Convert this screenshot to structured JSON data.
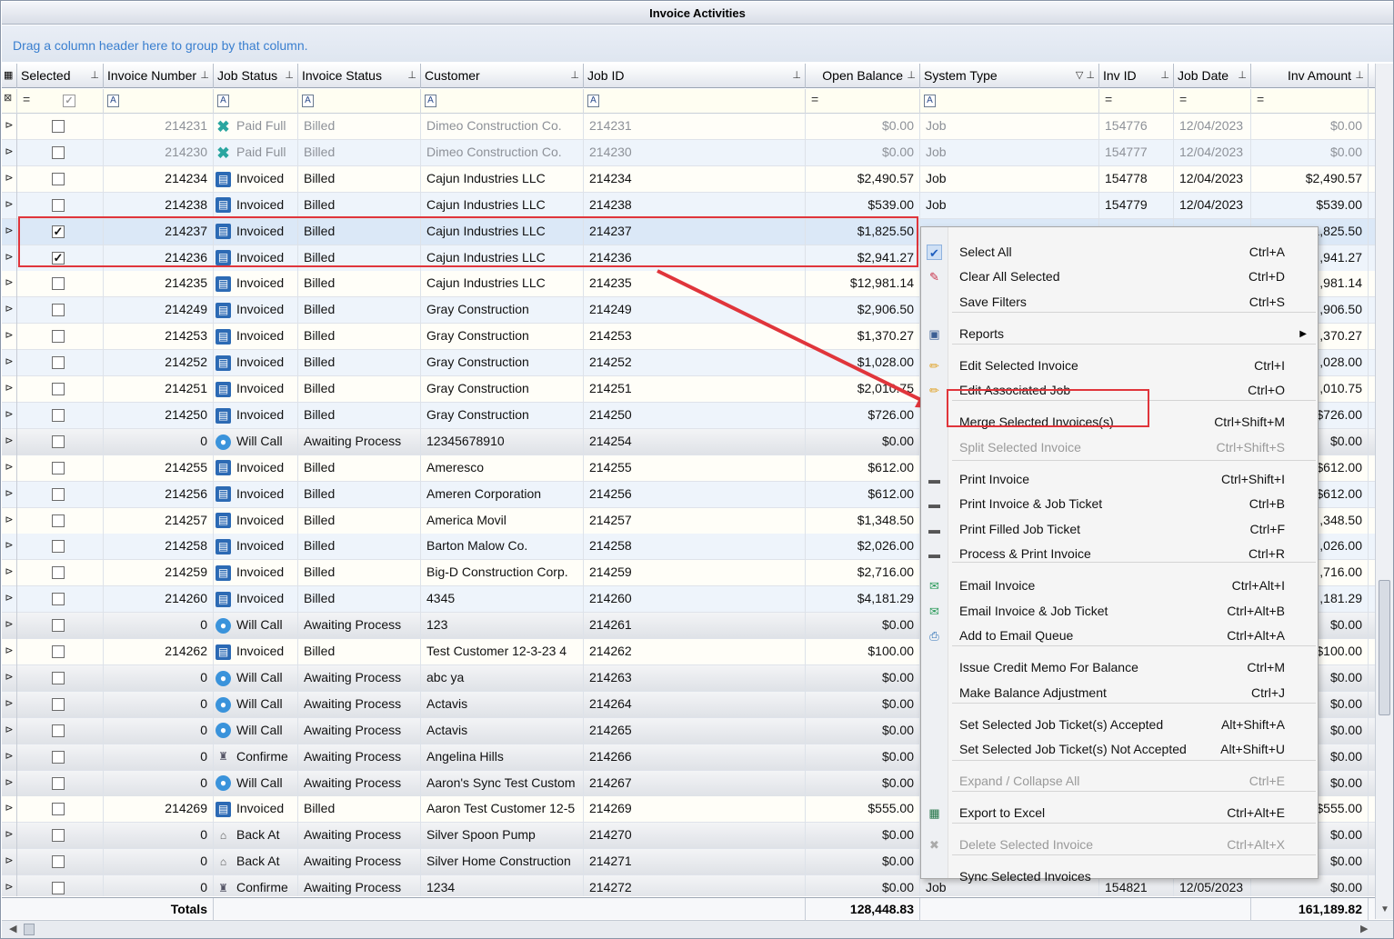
{
  "window": {
    "title": "Invoice Activities"
  },
  "group_hint": "Drag a column header here to group by that column.",
  "columns": [
    {
      "label": "Selected"
    },
    {
      "label": "Invoice Number"
    },
    {
      "label": "Job Status"
    },
    {
      "label": "Invoice Status"
    },
    {
      "label": "Customer"
    },
    {
      "label": "Job ID"
    },
    {
      "label": "Open Balance"
    },
    {
      "label": "System Type"
    },
    {
      "label": "Inv ID"
    },
    {
      "label": "Job Date"
    },
    {
      "label": "Inv Amount"
    }
  ],
  "rows": [
    {
      "selected": false,
      "inv": "214231",
      "job_status": "Paid Full",
      "icon": "paid-icon",
      "inv_status": "Billed",
      "customer": "Dimeo Construction Co.",
      "job_id": "214231",
      "balance": "$0.00",
      "system": "Job",
      "inv_id": "154776",
      "date": "12/04/2023",
      "amount": "$0.00",
      "style": "dim"
    },
    {
      "selected": false,
      "inv": "214230",
      "job_status": "Paid Full",
      "icon": "paid-icon",
      "inv_status": "Billed",
      "customer": "Dimeo Construction Co.",
      "job_id": "214230",
      "balance": "$0.00",
      "system": "Job",
      "inv_id": "154777",
      "date": "12/04/2023",
      "amount": "$0.00",
      "style": "dim alt"
    },
    {
      "selected": false,
      "inv": "214234",
      "job_status": "Invoiced",
      "icon": "invoice-icon",
      "inv_status": "Billed",
      "customer": "Cajun Industries LLC",
      "job_id": "214234",
      "balance": "$2,490.57",
      "system": "Job",
      "inv_id": "154778",
      "date": "12/04/2023",
      "amount": "$2,490.57",
      "style": ""
    },
    {
      "selected": false,
      "inv": "214238",
      "job_status": "Invoiced",
      "icon": "invoice-icon",
      "inv_status": "Billed",
      "customer": "Cajun Industries LLC",
      "job_id": "214238",
      "balance": "$539.00",
      "system": "Job",
      "inv_id": "154779",
      "date": "12/04/2023",
      "amount": "$539.00",
      "style": "alt"
    },
    {
      "selected": true,
      "inv": "214237",
      "job_status": "Invoiced",
      "icon": "invoice-icon",
      "inv_status": "Billed",
      "customer": "Cajun Industries LLC",
      "job_id": "214237",
      "balance": "$1,825.50",
      "system": "",
      "inv_id": "",
      "date": "",
      "amount": "1,825.50",
      "style": "sel"
    },
    {
      "selected": true,
      "inv": "214236",
      "job_status": "Invoiced",
      "icon": "invoice-icon",
      "inv_status": "Billed",
      "customer": "Cajun Industries LLC",
      "job_id": "214236",
      "balance": "$2,941.27",
      "system": "",
      "inv_id": "",
      "date": "",
      "amount": ",941.27",
      "style": "alt"
    },
    {
      "selected": false,
      "inv": "214235",
      "job_status": "Invoiced",
      "icon": "invoice-icon",
      "inv_status": "Billed",
      "customer": "Cajun Industries LLC",
      "job_id": "214235",
      "balance": "$12,981.14",
      "system": "",
      "inv_id": "",
      "date": "",
      "amount": ",981.14",
      "style": ""
    },
    {
      "selected": false,
      "inv": "214249",
      "job_status": "Invoiced",
      "icon": "invoice-icon",
      "inv_status": "Billed",
      "customer": "Gray Construction",
      "job_id": "214249",
      "balance": "$2,906.50",
      "system": "",
      "inv_id": "",
      "date": "",
      "amount": ",906.50",
      "style": "alt"
    },
    {
      "selected": false,
      "inv": "214253",
      "job_status": "Invoiced",
      "icon": "invoice-icon",
      "inv_status": "Billed",
      "customer": "Gray Construction",
      "job_id": "214253",
      "balance": "$1,370.27",
      "system": "",
      "inv_id": "",
      "date": "",
      "amount": ",370.27",
      "style": ""
    },
    {
      "selected": false,
      "inv": "214252",
      "job_status": "Invoiced",
      "icon": "invoice-icon",
      "inv_status": "Billed",
      "customer": "Gray Construction",
      "job_id": "214252",
      "balance": "$1,028.00",
      "system": "",
      "inv_id": "",
      "date": "",
      "amount": ",028.00",
      "style": "alt"
    },
    {
      "selected": false,
      "inv": "214251",
      "job_status": "Invoiced",
      "icon": "invoice-icon",
      "inv_status": "Billed",
      "customer": "Gray Construction",
      "job_id": "214251",
      "balance": "$2,010.75",
      "system": "",
      "inv_id": "",
      "date": "",
      "amount": ",010.75",
      "style": ""
    },
    {
      "selected": false,
      "inv": "214250",
      "job_status": "Invoiced",
      "icon": "invoice-icon",
      "inv_status": "Billed",
      "customer": "Gray Construction",
      "job_id": "214250",
      "balance": "$726.00",
      "system": "",
      "inv_id": "",
      "date": "",
      "amount": "$726.00",
      "style": "alt"
    },
    {
      "selected": false,
      "inv": "0",
      "job_status": "Will Call",
      "icon": "will-call-icon",
      "inv_status": "Awaiting Process",
      "customer": "12345678910",
      "job_id": "214254",
      "balance": "$0.00",
      "system": "",
      "inv_id": "",
      "date": "",
      "amount": "$0.00",
      "style": "gry"
    },
    {
      "selected": false,
      "inv": "214255",
      "job_status": "Invoiced",
      "icon": "invoice-icon",
      "inv_status": "Billed",
      "customer": "Ameresco",
      "job_id": "214255",
      "balance": "$612.00",
      "system": "",
      "inv_id": "",
      "date": "",
      "amount": "$612.00",
      "style": ""
    },
    {
      "selected": false,
      "inv": "214256",
      "job_status": "Invoiced",
      "icon": "invoice-icon",
      "inv_status": "Billed",
      "customer": "Ameren Corporation",
      "job_id": "214256",
      "balance": "$612.00",
      "system": "",
      "inv_id": "",
      "date": "",
      "amount": "$612.00",
      "style": "alt"
    },
    {
      "selected": false,
      "inv": "214257",
      "job_status": "Invoiced",
      "icon": "invoice-icon",
      "inv_status": "Billed",
      "customer": "America Movil",
      "job_id": "214257",
      "balance": "$1,348.50",
      "system": "",
      "inv_id": "",
      "date": "",
      "amount": ",348.50",
      "style": ""
    },
    {
      "selected": false,
      "inv": "214258",
      "job_status": "Invoiced",
      "icon": "invoice-icon",
      "inv_status": "Billed",
      "customer": "Barton Malow Co.",
      "job_id": "214258",
      "balance": "$2,026.00",
      "system": "",
      "inv_id": "",
      "date": "",
      "amount": ",026.00",
      "style": "alt"
    },
    {
      "selected": false,
      "inv": "214259",
      "job_status": "Invoiced",
      "icon": "invoice-icon",
      "inv_status": "Billed",
      "customer": "Big-D Construction Corp.",
      "job_id": "214259",
      "balance": "$2,716.00",
      "system": "",
      "inv_id": "",
      "date": "",
      "amount": ",716.00",
      "style": ""
    },
    {
      "selected": false,
      "inv": "214260",
      "job_status": "Invoiced",
      "icon": "invoice-icon",
      "inv_status": "Billed",
      "customer": "4345",
      "job_id": "214260",
      "balance": "$4,181.29",
      "system": "",
      "inv_id": "",
      "date": "",
      "amount": ",181.29",
      "style": "alt"
    },
    {
      "selected": false,
      "inv": "0",
      "job_status": "Will Call",
      "icon": "will-call-icon",
      "inv_status": "Awaiting Process",
      "customer": "123",
      "job_id": "214261",
      "balance": "$0.00",
      "system": "",
      "inv_id": "",
      "date": "",
      "amount": "$0.00",
      "style": "gry"
    },
    {
      "selected": false,
      "inv": "214262",
      "job_status": "Invoiced",
      "icon": "invoice-icon",
      "inv_status": "Billed",
      "customer": "Test Customer 12-3-23 4",
      "job_id": "214262",
      "balance": "$100.00",
      "system": "",
      "inv_id": "",
      "date": "",
      "amount": "$100.00",
      "style": ""
    },
    {
      "selected": false,
      "inv": "0",
      "job_status": "Will Call",
      "icon": "will-call-icon",
      "inv_status": "Awaiting Process",
      "customer": "abc ya",
      "job_id": "214263",
      "balance": "$0.00",
      "system": "",
      "inv_id": "",
      "date": "",
      "amount": "$0.00",
      "style": "gry"
    },
    {
      "selected": false,
      "inv": "0",
      "job_status": "Will Call",
      "icon": "will-call-icon",
      "inv_status": "Awaiting Process",
      "customer": "Actavis",
      "job_id": "214264",
      "balance": "$0.00",
      "system": "",
      "inv_id": "",
      "date": "",
      "amount": "$0.00",
      "style": "gry"
    },
    {
      "selected": false,
      "inv": "0",
      "job_status": "Will Call",
      "icon": "will-call-icon",
      "inv_status": "Awaiting Process",
      "customer": "Actavis",
      "job_id": "214265",
      "balance": "$0.00",
      "system": "",
      "inv_id": "",
      "date": "",
      "amount": "$0.00",
      "style": "gry"
    },
    {
      "selected": false,
      "inv": "0",
      "job_status": "Confirme",
      "icon": "confirmed-icon",
      "inv_status": "Awaiting Process",
      "customer": "Angelina Hills",
      "job_id": "214266",
      "balance": "$0.00",
      "system": "",
      "inv_id": "",
      "date": "",
      "amount": "$0.00",
      "style": "gry"
    },
    {
      "selected": false,
      "inv": "0",
      "job_status": "Will Call",
      "icon": "will-call-icon",
      "inv_status": "Awaiting Process",
      "customer": "Aaron's Sync Test Custom",
      "job_id": "214267",
      "balance": "$0.00",
      "system": "",
      "inv_id": "",
      "date": "",
      "amount": "$0.00",
      "style": "gry"
    },
    {
      "selected": false,
      "inv": "214269",
      "job_status": "Invoiced",
      "icon": "invoice-icon",
      "inv_status": "Billed",
      "customer": "Aaron Test Customer 12-5",
      "job_id": "214269",
      "balance": "$555.00",
      "system": "",
      "inv_id": "",
      "date": "",
      "amount": "$555.00",
      "style": ""
    },
    {
      "selected": false,
      "inv": "0",
      "job_status": "Back At",
      "icon": "back-at-icon",
      "inv_status": "Awaiting Process",
      "customer": "Silver Spoon Pump",
      "job_id": "214270",
      "balance": "$0.00",
      "system": "",
      "inv_id": "",
      "date": "",
      "amount": "$0.00",
      "style": "gry"
    },
    {
      "selected": false,
      "inv": "0",
      "job_status": "Back At",
      "icon": "back-at-icon",
      "inv_status": "Awaiting Process",
      "customer": "Silver Home Construction",
      "job_id": "214271",
      "balance": "$0.00",
      "system": "",
      "inv_id": "",
      "date": "",
      "amount": "$0.00",
      "style": "gry"
    },
    {
      "selected": false,
      "inv": "0",
      "job_status": "Confirme",
      "icon": "confirmed-icon",
      "inv_status": "Awaiting Process",
      "customer": "1234",
      "job_id": "214272",
      "balance": "$0.00",
      "system": "Job",
      "inv_id": "154821",
      "date": "12/05/2023",
      "amount": "$0.00",
      "style": "gry"
    }
  ],
  "totals": {
    "label": "Totals",
    "open_balance": "128,448.83",
    "inv_amount": "161,189.82"
  },
  "context_menu": {
    "items": [
      {
        "label": "Select All",
        "shortcut": "Ctrl+A",
        "icon": "check-icon",
        "disabled": false
      },
      {
        "label": "Clear All Selected",
        "shortcut": "Ctrl+D",
        "icon": "eraser-icon",
        "disabled": false
      },
      {
        "label": "Save Filters",
        "shortcut": "Ctrl+S",
        "icon": "",
        "disabled": false
      },
      {
        "label": "Reports",
        "shortcut": "",
        "icon": "reports-icon",
        "disabled": false,
        "submenu": true
      },
      {
        "label": "Edit Selected Invoice",
        "shortcut": "Ctrl+I",
        "icon": "pencil-icon",
        "disabled": false
      },
      {
        "label": "Edit Associated Job",
        "shortcut": "Ctrl+O",
        "icon": "pencil-icon",
        "disabled": false
      },
      {
        "label": "Merge Selected Invoices(s)",
        "shortcut": "Ctrl+Shift+M",
        "icon": "",
        "disabled": false
      },
      {
        "label": "Split Selected Invoice",
        "shortcut": "Ctrl+Shift+S",
        "icon": "",
        "disabled": true
      },
      {
        "label": "Print Invoice",
        "shortcut": "Ctrl+Shift+I",
        "icon": "printer-icon",
        "disabled": false
      },
      {
        "label": "Print Invoice & Job Ticket",
        "shortcut": "Ctrl+B",
        "icon": "printer-icon",
        "disabled": false
      },
      {
        "label": "Print Filled Job Ticket",
        "shortcut": "Ctrl+F",
        "icon": "printer-icon",
        "disabled": false
      },
      {
        "label": "Process & Print Invoice",
        "shortcut": "Ctrl+R",
        "icon": "printer-icon",
        "disabled": false
      },
      {
        "label": "Email Invoice",
        "shortcut": "Ctrl+Alt+I",
        "icon": "email-icon",
        "disabled": false
      },
      {
        "label": "Email Invoice & Job Ticket",
        "shortcut": "Ctrl+Alt+B",
        "icon": "email-icon",
        "disabled": false
      },
      {
        "label": "Add to Email Queue",
        "shortcut": "Ctrl+Alt+A",
        "icon": "inbox-icon",
        "disabled": false
      },
      {
        "label": "Issue Credit Memo For Balance",
        "shortcut": "Ctrl+M",
        "icon": "",
        "disabled": false
      },
      {
        "label": "Make Balance Adjustment",
        "shortcut": "Ctrl+J",
        "icon": "",
        "disabled": false
      },
      {
        "label": "Set Selected Job Ticket(s) Accepted",
        "shortcut": "Alt+Shift+A",
        "icon": "",
        "disabled": false
      },
      {
        "label": "Set Selected Job Ticket(s) Not Accepted",
        "shortcut": "Alt+Shift+U",
        "icon": "",
        "disabled": false
      },
      {
        "label": "Expand / Collapse All",
        "shortcut": "Ctrl+E",
        "icon": "",
        "disabled": true
      },
      {
        "label": "Export to Excel",
        "shortcut": "Ctrl+Alt+E",
        "icon": "excel-icon",
        "disabled": false
      },
      {
        "label": "Delete Selected Invoice",
        "shortcut": "Ctrl+Alt+X",
        "icon": "delete-icon",
        "disabled": true
      },
      {
        "label": "Sync Selected Invoices",
        "shortcut": "",
        "icon": "",
        "disabled": false
      }
    ]
  },
  "colors": {
    "highlight": "#e0353b",
    "link": "#3a7fcf",
    "invoice_icon": "#2c6ab4"
  }
}
